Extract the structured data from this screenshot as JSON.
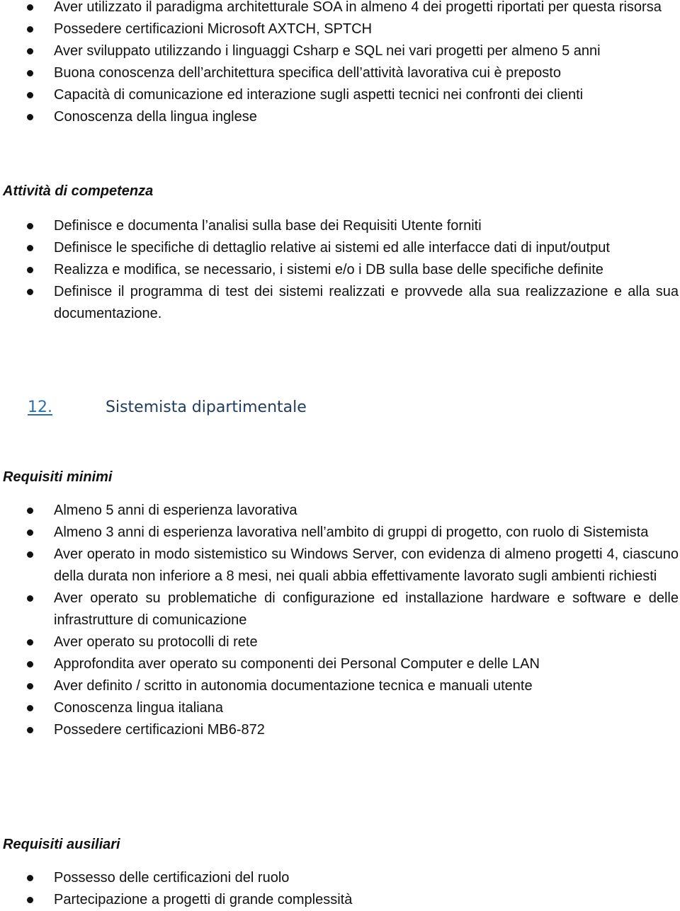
{
  "document": {
    "top_list": [
      "Aver utilizzato il paradigma architetturale SOA in almeno 4 dei progetti riportati per questa risorsa",
      "Possedere certificazioni Microsoft AXTCH, SPTCH",
      "Aver sviluppato utilizzando i linguaggi Csharp e SQL nei vari progetti per almeno 5 anni",
      "Buona conoscenza dell’architettura specifica dell’attività lavorativa cui è preposto",
      "Capacità di comunicazione ed interazione sugli aspetti tecnici nei confronti dei clienti",
      "Conoscenza della lingua inglese"
    ],
    "attivita_heading": "Attività di competenza",
    "attivita_list": [
      "Definisce e documenta l’analisi sulla base dei Requisiti Utente forniti",
      "Definisce le specifiche di dettaglio relative ai sistemi ed alle interfacce dati di input/output",
      "Realizza e modifica, se necessario, i sistemi e/o i DB sulla base delle specifiche definite",
      "Definisce il programma di test dei sistemi realizzati e provvede alla sua realizzazione e alla sua documentazione."
    ],
    "section": {
      "number": "12.",
      "title": "Sistemista dipartimentale"
    },
    "requisiti_minimi_heading": "Requisiti minimi",
    "requisiti_minimi_list": [
      "Almeno 5 anni di esperienza lavorativa",
      "Almeno 3 anni di esperienza lavorativa nell’ambito di gruppi di progetto, con ruolo di Sistemista",
      "Aver operato in modo sistemistico su Windows Server, con evidenza di almeno progetti 4, ciascuno della durata non inferiore a 8 mesi, nei quali abbia effettivamente lavorato sugli ambienti richiesti",
      "Aver operato su problematiche di configurazione ed installazione hardware e software e delle infrastrutture di comunicazione",
      "Aver operato su protocolli di rete",
      "Approfondita aver operato su componenti dei Personal Computer e delle LAN",
      "Aver definito / scritto in autonomia documentazione tecnica e manuali utente",
      "Conoscenza lingua italiana",
      "Possedere certificazioni MB6-872"
    ],
    "requisiti_ausiliari_heading": "Requisiti ausiliari",
    "requisiti_ausiliari_list": [
      "Possesso delle certificazioni del ruolo",
      "Partecipazione a progetti di grande complessità"
    ]
  }
}
